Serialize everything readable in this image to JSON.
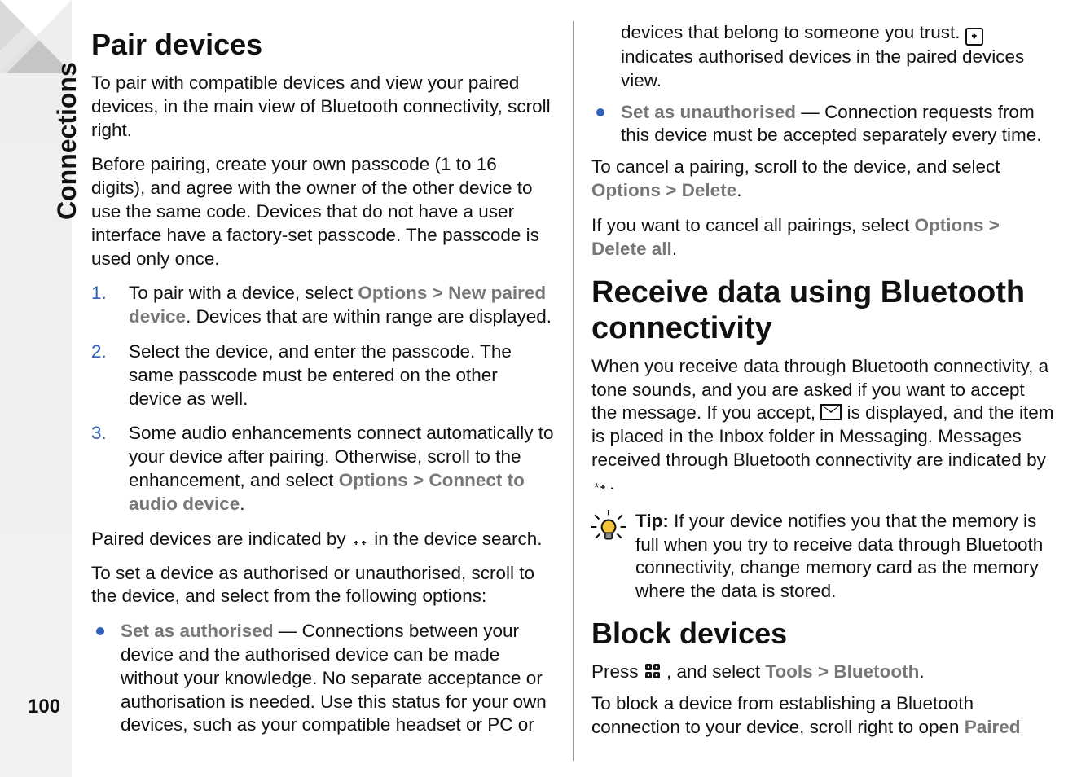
{
  "side_tab": "Connections",
  "page_number": "100",
  "h_pair": "Pair devices",
  "p_pair_intro": "To pair with compatible devices and view your paired devices, in the main view of Bluetooth connectivity, scroll right.",
  "p_before_pair": "Before pairing, create your own passcode (1 to 16 digits), and agree with the owner of the other device to use the same code. Devices that do not have a user interface have a factory-set passcode. The passcode is used only once.",
  "step1_num": "1.",
  "step1_a": "To pair with a device, select ",
  "step1_m1": "Options",
  "step1_chev": ">",
  "step1_m2": "New paired device",
  "step1_b": ". Devices that are within range are displayed.",
  "step2_num": "2.",
  "step2": "Select the device, and enter the passcode. The same passcode must be entered on the other device as well.",
  "step3_num": "3.",
  "step3_a": "Some audio enhancements connect automatically to your device after pairing. Otherwise, scroll to the enhancement, and select ",
  "step3_m1": "Options",
  "step3_chev": ">",
  "step3_m2": "Connect to audio device",
  "step3_b": ".",
  "p_paired_ind_a": "Paired devices are indicated by ",
  "p_paired_ind_b": " in the device search.",
  "p_auth_intro": "To set a device as authorised or unauthorised, scroll to the device, and select from the following options:",
  "auth_label": "Set as authorised",
  "auth_dash": " — ",
  "auth_text_a": "Connections between your device and the authorised device can be made without your knowledge. No separate acceptance or authorisation is needed. Use this status for your own devices, such as your compatible headset or PC or devices that belong to someone you trust. ",
  "auth_text_b": " indicates authorised devices in the paired devices view.",
  "unauth_label": "Set as unauthorised",
  "unauth_dash": " — ",
  "unauth_text": "Connection requests from this device must be accepted separately every time.",
  "p_cancel_a": "To cancel a pairing, scroll to the device, and select ",
  "p_cancel_m1": "Options",
  "p_cancel_chev": ">",
  "p_cancel_m2": "Delete",
  "p_cancel_b": ".",
  "p_cancel_all_a": "If you want to cancel all pairings, select ",
  "p_cancel_all_m1": "Options",
  "p_cancel_all_chev": ">",
  "p_cancel_all_m2": "Delete all",
  "p_cancel_all_b": ".",
  "h_receive": "Receive data using Bluetooth connectivity",
  "p_receive_a": "When you receive data through Bluetooth connectivity, a tone sounds, and you are asked if you want to accept the message. If you accept, ",
  "p_receive_b": " is displayed, and the item is placed in the Inbox folder in Messaging. Messages received through Bluetooth connectivity are indicated by ",
  "p_receive_c": ".",
  "tip_label": "Tip:  ",
  "tip_text": "If your device notifies you that the memory is full when you try to receive data through Bluetooth connectivity, change memory card as the memory where the data is stored.",
  "h_block": "Block devices",
  "p_block_press_a": "Press ",
  "p_block_press_b": " , and select ",
  "p_block_m1": "Tools",
  "p_block_chev": ">",
  "p_block_m2": "Bluetooth",
  "p_block_press_c": ".",
  "p_block2_a": "To block a device from establishing a Bluetooth connection to your device, scroll right to open ",
  "p_block2_m": "Paired",
  "icons": {
    "bt_pair": "᛭᛭",
    "bt_auth_box": "᛭",
    "bt_msg": "*᛭",
    "menu_key": "⌘"
  }
}
